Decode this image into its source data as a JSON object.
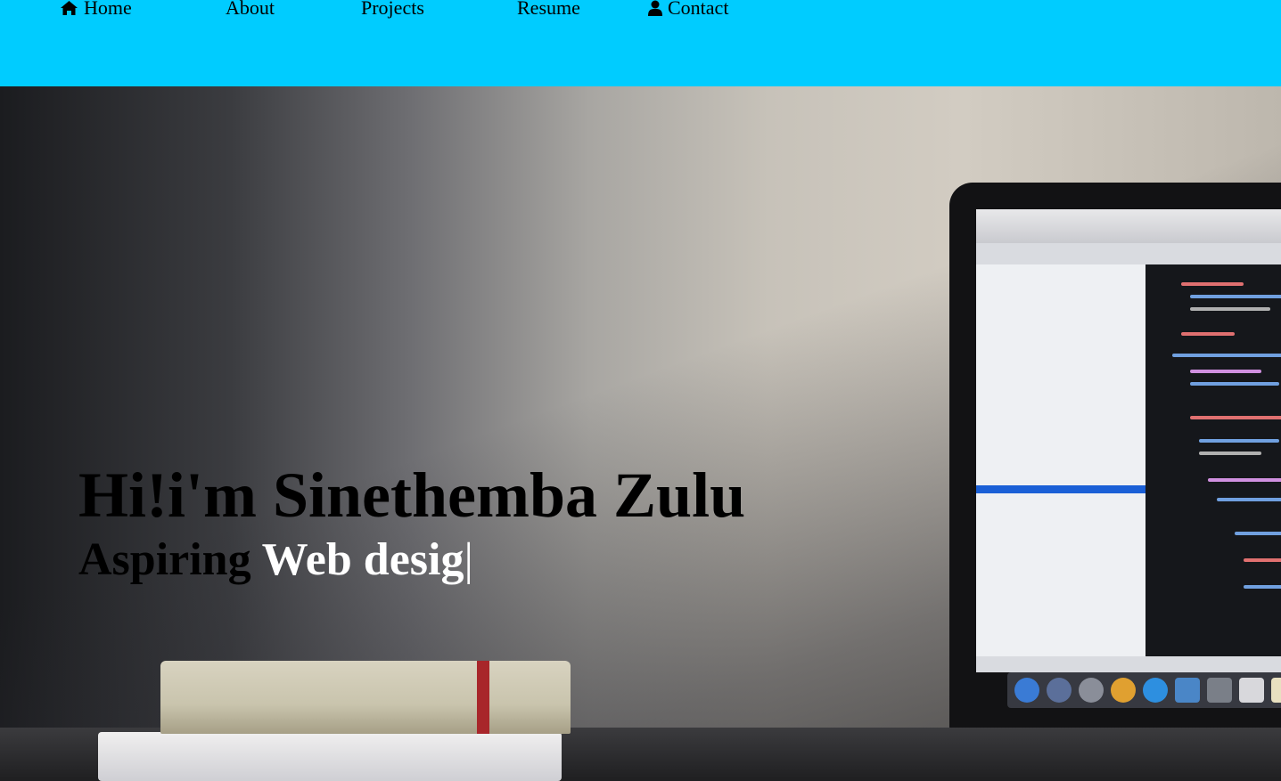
{
  "nav": {
    "items": [
      {
        "label": "Home",
        "icon": "home-icon"
      },
      {
        "label": "About"
      },
      {
        "label": "Projects"
      },
      {
        "label": "Resume"
      },
      {
        "label": "Contact",
        "icon": "user-icon"
      }
    ],
    "background": "#00ccff"
  },
  "hero": {
    "greeting": "Hi!i'm Sinethemba Zulu",
    "role_prefix": "Aspiring",
    "role_typed": "Web desig",
    "cursor": "|"
  }
}
